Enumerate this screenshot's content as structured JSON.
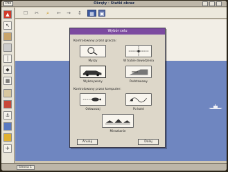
{
  "window": {
    "title": "Okręty · Statki obraz",
    "app_button": "Plik"
  },
  "toolbar": {
    "tools": [
      "☐",
      "✂",
      "⌕",
      "←",
      "→",
      "↕",
      "▦",
      "▣"
    ]
  },
  "dialog": {
    "title": "Wybór celu",
    "section_1": "Kontrolowany przez gracza:",
    "section_2": "Kontrolowany przez komputer:",
    "options": {
      "o1": "Myszy",
      "o2": "W trybie dowodzenia",
      "o3": "Wykonywany",
      "o4": "Podstawowy",
      "o5": "Odtwarzaj",
      "o6": "Po kolei",
      "o7": "Mieszkanie"
    },
    "ok_label": "Anuluj",
    "cancel_label": "Dalej"
  },
  "status": {
    "field": "Strona 1"
  }
}
